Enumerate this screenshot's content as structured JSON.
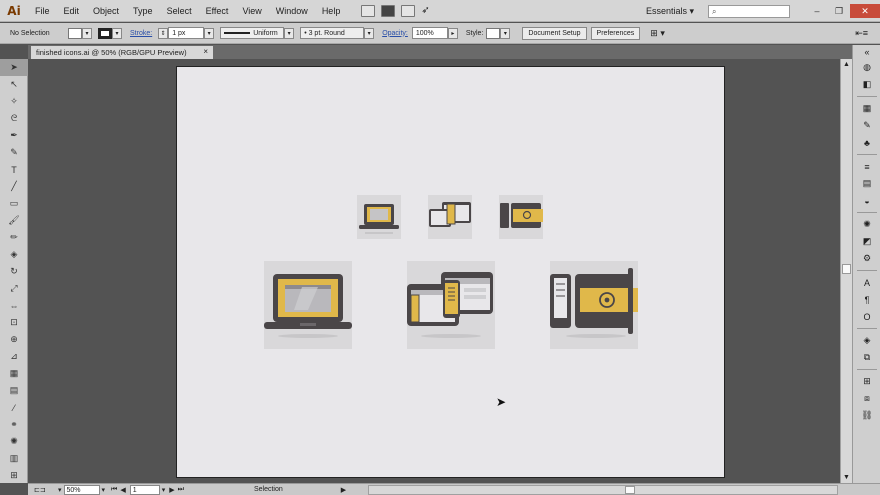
{
  "app": {
    "logo": "Ai"
  },
  "menu": [
    "File",
    "Edit",
    "Object",
    "Type",
    "Select",
    "Effect",
    "View",
    "Window",
    "Help"
  ],
  "workspace": "Essentials",
  "control": {
    "selection": "No Selection",
    "stroke_label": "Stroke:",
    "stroke_weight": "1 px",
    "profile": "Uniform",
    "brush": "3 pt. Round",
    "opacity_label": "Opacity:",
    "opacity": "100%",
    "style_label": "Style:",
    "doc_setup": "Document Setup",
    "preferences": "Preferences"
  },
  "document": {
    "tab_title": "finished icons.ai @ 50% (RGB/GPU Preview)"
  },
  "status": {
    "zoom": "50%",
    "artboard": "1",
    "mode": "Selection"
  },
  "colors": {
    "accent": "#e0b84a",
    "dark": "#4a4648",
    "artboard": "#e8e7ea"
  },
  "icons": [
    "laptop",
    "laptop-and-tablet",
    "computer-and-game-console"
  ]
}
